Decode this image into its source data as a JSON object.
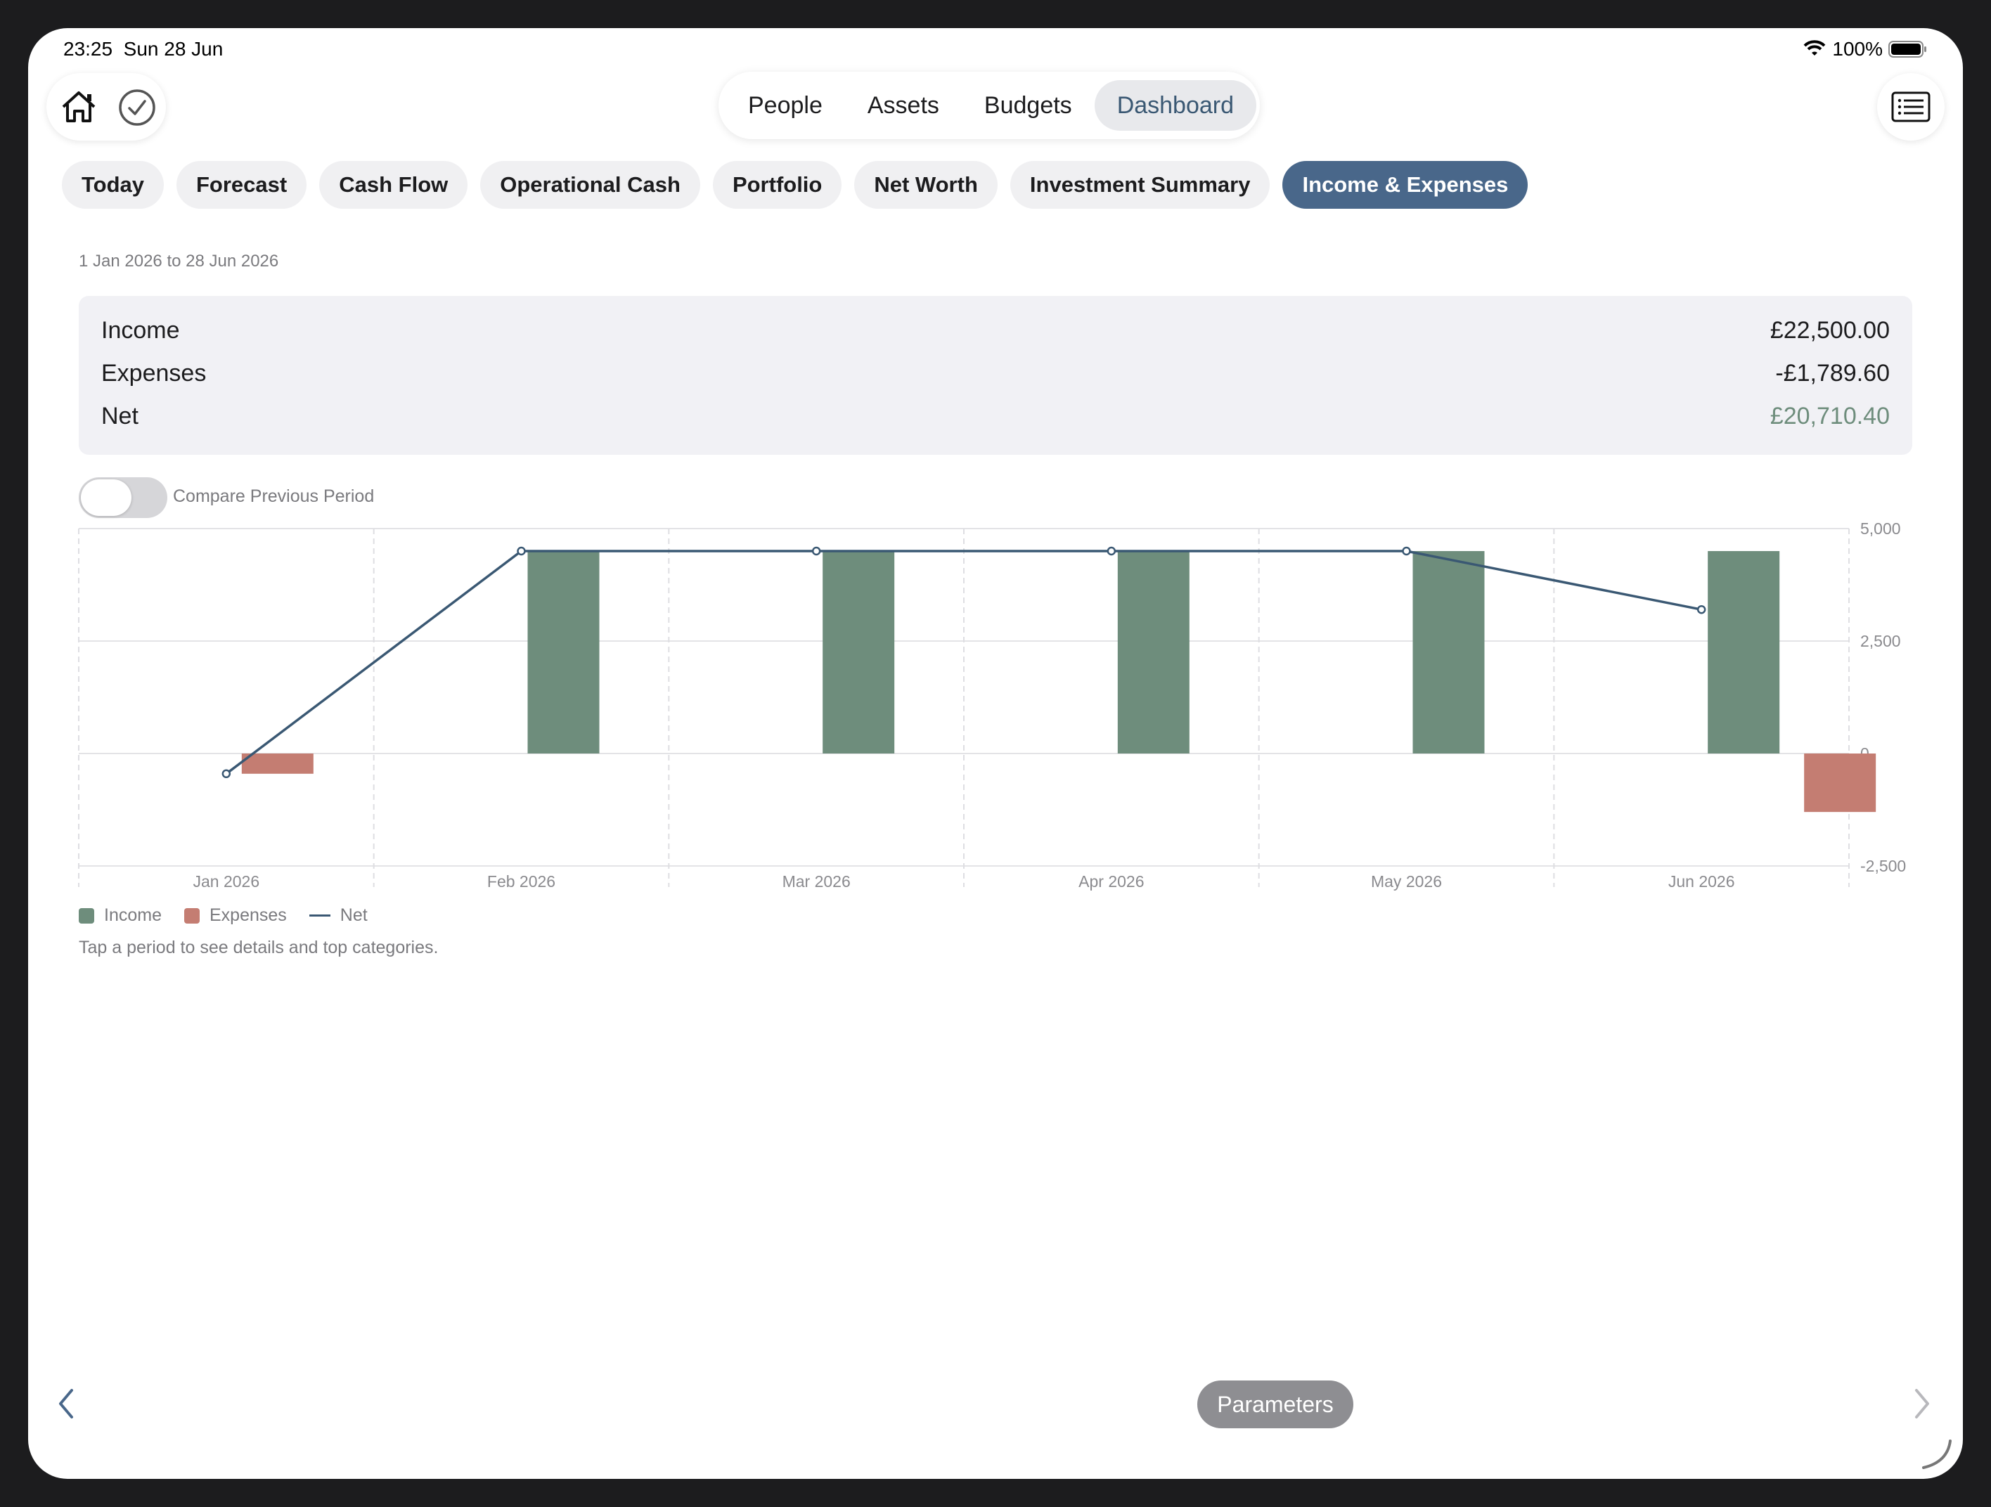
{
  "status": {
    "time": "23:25",
    "date": "Sun 28 Jun",
    "battery": "100%"
  },
  "top_icons": {
    "left": [
      "home-icon",
      "checkmark-circle-icon"
    ],
    "right": "list-icon"
  },
  "segments": [
    {
      "label": "People",
      "active": false
    },
    {
      "label": "Assets",
      "active": false
    },
    {
      "label": "Budgets",
      "active": false
    },
    {
      "label": "Dashboard",
      "active": true
    }
  ],
  "chips": [
    {
      "label": "Today",
      "active": false
    },
    {
      "label": "Forecast",
      "active": false
    },
    {
      "label": "Cash Flow",
      "active": false
    },
    {
      "label": "Operational Cash",
      "active": false
    },
    {
      "label": "Portfolio",
      "active": false
    },
    {
      "label": "Net Worth",
      "active": false
    },
    {
      "label": "Investment Summary",
      "active": false
    },
    {
      "label": "Income & Expenses",
      "active": true
    }
  ],
  "date_range": "1 Jan 2026 to 28 Jun 2026",
  "summary": {
    "rows": [
      {
        "label": "Income",
        "value": "£22,500.00"
      },
      {
        "label": "Expenses",
        "value": "-£1,789.60"
      },
      {
        "label": "Net",
        "value": "£20,710.40"
      }
    ]
  },
  "compare": {
    "label": "Compare Previous Period",
    "on": false
  },
  "colors": {
    "income": "#6e8d7c",
    "expenses": "#c47d72",
    "net": "#3a5873",
    "accent": "#49678a",
    "net_value": "#6e8d7c"
  },
  "chart_data": {
    "type": "bar",
    "categories": [
      "Jan 2026",
      "Feb 2026",
      "Mar 2026",
      "Apr 2026",
      "May 2026",
      "Jun 2026"
    ],
    "series": [
      {
        "name": "Income",
        "values": [
          0,
          4500,
          4500,
          4500,
          4500,
          4500
        ]
      },
      {
        "name": "Expenses",
        "values": [
          -450,
          0,
          0,
          0,
          0,
          -1300
        ]
      },
      {
        "name": "Net",
        "type": "line",
        "values": [
          -450,
          4500,
          4500,
          4500,
          4500,
          3200
        ]
      }
    ],
    "yticks": [
      "5,000",
      "2,500",
      "0",
      "-2,500"
    ],
    "ytick_values": [
      5000,
      2500,
      0,
      -2500
    ],
    "ylim": [
      -2500,
      5000
    ],
    "grid": true,
    "legend": "bottom-left"
  },
  "hint": "Tap a period to see details and top categories.",
  "params_label": "Parameters"
}
